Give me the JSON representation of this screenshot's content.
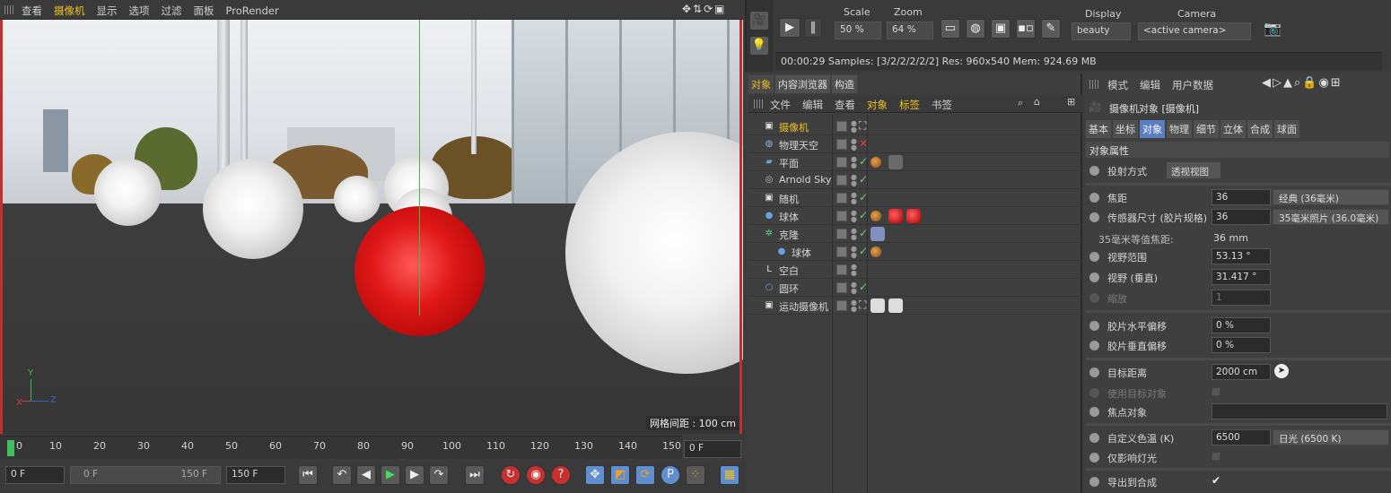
{
  "viewport_menu": [
    "查看",
    "摄像机",
    "显示",
    "选项",
    "过滤",
    "面板",
    "ProRender"
  ],
  "viewport": {
    "grid_spacing": "网格间距 : 100 cm",
    "axis_x": "X",
    "axis_y": "Y",
    "axis_z": "Z"
  },
  "timeline": {
    "ticks": [
      "0",
      "10",
      "20",
      "30",
      "40",
      "50",
      "60",
      "70",
      "80",
      "90",
      "100",
      "110",
      "120",
      "130",
      "140",
      "150"
    ],
    "current_frame": "0 F",
    "start_field": "0 F",
    "range_start": "0 F",
    "range_end": "150 F",
    "end_field": "150 F"
  },
  "render_toolbar": {
    "scale_label": "Scale",
    "scale_value": "50 %",
    "zoom_label": "Zoom",
    "zoom_value": "64 %",
    "display_label": "Display",
    "display_value": "beauty",
    "camera_label": "Camera",
    "camera_value": "<active camera>",
    "status": "00:00:29  Samples: [3/2/2/2/2/2]  Res: 960x540  Mem: 924.69 MB"
  },
  "object_manager": {
    "tabs": [
      "对象",
      "内容浏览器",
      "构造"
    ],
    "menu": [
      "文件",
      "编辑",
      "查看",
      "对象",
      "标签",
      "书签"
    ],
    "objects": [
      {
        "name": "摄像机",
        "color": "#f0c020",
        "icon": "camera-icon"
      },
      {
        "name": "物理天空",
        "color": "#d6d6d6",
        "icon": "sky-icon"
      },
      {
        "name": "平面",
        "color": "#d6d6d6",
        "icon": "plane-icon"
      },
      {
        "name": "Arnold Sky",
        "color": "#d6d6d6",
        "icon": "arnold-sky-icon"
      },
      {
        "name": "随机",
        "color": "#d6d6d6",
        "icon": "random-effector-icon"
      },
      {
        "name": "球体",
        "color": "#d6d6d6",
        "icon": "sphere-icon"
      },
      {
        "name": "克隆",
        "color": "#d6d6d6",
        "icon": "cloner-icon"
      },
      {
        "name": "球体",
        "color": "#d6d6d6",
        "icon": "sphere-icon"
      },
      {
        "name": "空白",
        "color": "#d6d6d6",
        "icon": "null-icon"
      },
      {
        "name": "圆环",
        "color": "#d6d6d6",
        "icon": "circle-spline-icon"
      },
      {
        "name": "运动摄像机",
        "color": "#d6d6d6",
        "icon": "motion-camera-icon"
      }
    ]
  },
  "attributes": {
    "menu": [
      "模式",
      "编辑",
      "用户数据"
    ],
    "title": "摄像机对象 [摄像机]",
    "tabs": [
      "基本",
      "坐标",
      "对象",
      "物理",
      "细节",
      "立体",
      "合成",
      "球面"
    ],
    "section": "对象属性",
    "projection_label": "投射方式",
    "projection_value": "透视视图",
    "focal_label": "焦距",
    "focal_value": "36",
    "focal_preset": "经典 (36毫米)",
    "sensor_label": "传感器尺寸 (胶片规格)",
    "sensor_value": "36",
    "sensor_preset": "35毫米照片 (36.0毫米)",
    "equiv_label": "35毫米等值焦距:",
    "equiv_value": "36 mm",
    "fov_label": "视野范围",
    "fov_value": "53.13 °",
    "fov_v_label": "视野 (垂直)",
    "fov_v_value": "31.417 °",
    "zoom_label": "缩放",
    "zoom_value": "1",
    "hshift_label": "胶片水平偏移",
    "hshift_value": "0 %",
    "vshift_label": "胶片垂直偏移",
    "vshift_value": "0 %",
    "target_label": "目标距离",
    "target_value": "2000 cm",
    "use_target_label": "使用目标对象",
    "focus_label": "焦点对象",
    "wb_label": "自定义色温 (K)",
    "wb_value": "6500",
    "wb_preset": "日光 (6500 K)",
    "only_light_label": "仅影响灯光",
    "export_label": "导出到合成"
  }
}
